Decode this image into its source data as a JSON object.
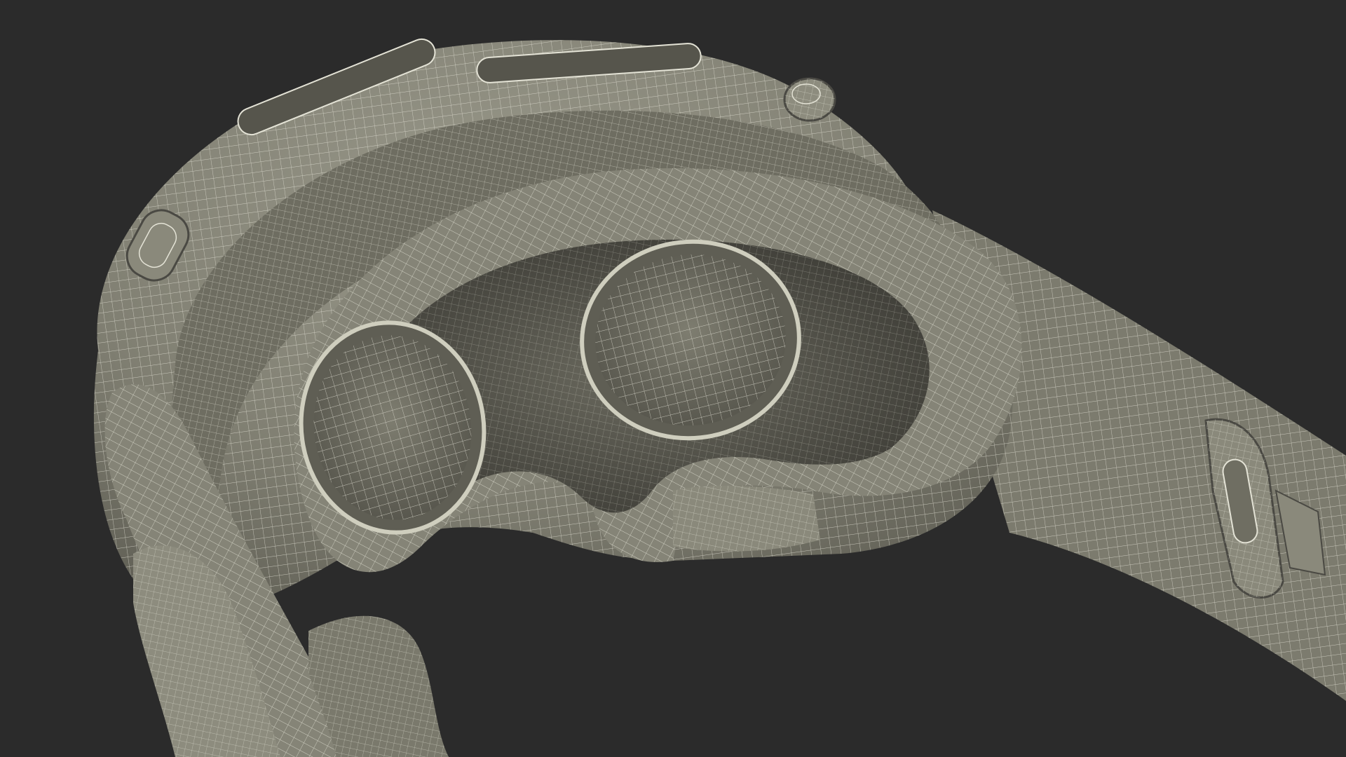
{
  "scene": {
    "subject": "vr-headset-wireframe-render",
    "colors": {
      "background": "#2b2b2b",
      "surface": "#807f72",
      "surface_light": "#9a998b",
      "surface_dark": "#56554c",
      "cavity": "#3a3934",
      "wire": "#e4e3d6"
    },
    "icons": {
      "headset": "headset-icon",
      "lens_left": "lens-icon",
      "lens_right": "lens-icon",
      "button": "button-icon",
      "strap_buckle": "buckle-icon"
    }
  }
}
